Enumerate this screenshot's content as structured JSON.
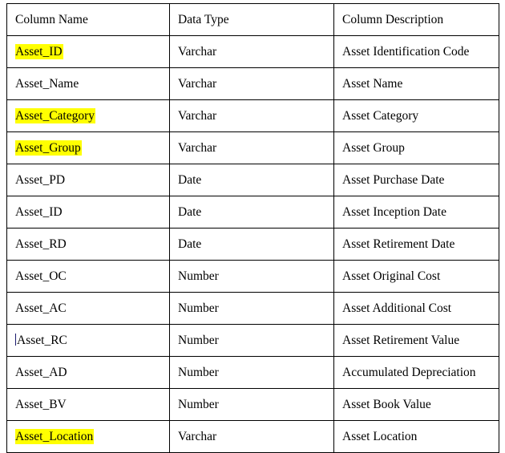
{
  "document": {
    "kind": "data-dictionary-table",
    "caret_visible": true,
    "caret_row_index": 9
  },
  "colors": {
    "highlight": "#ffff00",
    "text": "#000000",
    "border": "#000000",
    "background": "#ffffff",
    "caret": "#1a1a6e"
  },
  "table": {
    "headers": [
      "Column Name",
      "Data Type",
      "Column Description"
    ],
    "rows": [
      {
        "name": "Asset_ID",
        "type": "Varchar",
        "description": "Asset Identification Code",
        "highlighted": true,
        "caret": false
      },
      {
        "name": "Asset_Name",
        "type": "Varchar",
        "description": "Asset Name",
        "highlighted": false,
        "caret": false
      },
      {
        "name": "Asset_Category",
        "type": "Varchar",
        "description": "Asset Category",
        "highlighted": true,
        "caret": false
      },
      {
        "name": "Asset_Group",
        "type": "Varchar",
        "description": "Asset Group",
        "highlighted": true,
        "caret": false
      },
      {
        "name": "Asset_PD",
        "type": "Date",
        "description": "Asset Purchase Date",
        "highlighted": false,
        "caret": false
      },
      {
        "name": "Asset_ID",
        "type": "Date",
        "description": "Asset Inception Date",
        "highlighted": false,
        "caret": false
      },
      {
        "name": "Asset_RD",
        "type": "Date",
        "description": "Asset Retirement Date",
        "highlighted": false,
        "caret": false
      },
      {
        "name": "Asset_OC",
        "type": "Number",
        "description": "Asset Original Cost",
        "highlighted": false,
        "caret": false
      },
      {
        "name": "Asset_AC",
        "type": "Number",
        "description": "Asset Additional Cost",
        "highlighted": false,
        "caret": false
      },
      {
        "name": "Asset_RC",
        "type": "Number",
        "description": "Asset Retirement Value",
        "highlighted": false,
        "caret": true
      },
      {
        "name": "Asset_AD",
        "type": "Number",
        "description": "Accumulated Depreciation",
        "highlighted": false,
        "caret": false
      },
      {
        "name": "Asset_BV",
        "type": "Number",
        "description": "Asset Book Value",
        "highlighted": false,
        "caret": false
      },
      {
        "name": "Asset_Location",
        "type": "Varchar",
        "description": "Asset Location",
        "highlighted": true,
        "caret": false
      }
    ]
  }
}
